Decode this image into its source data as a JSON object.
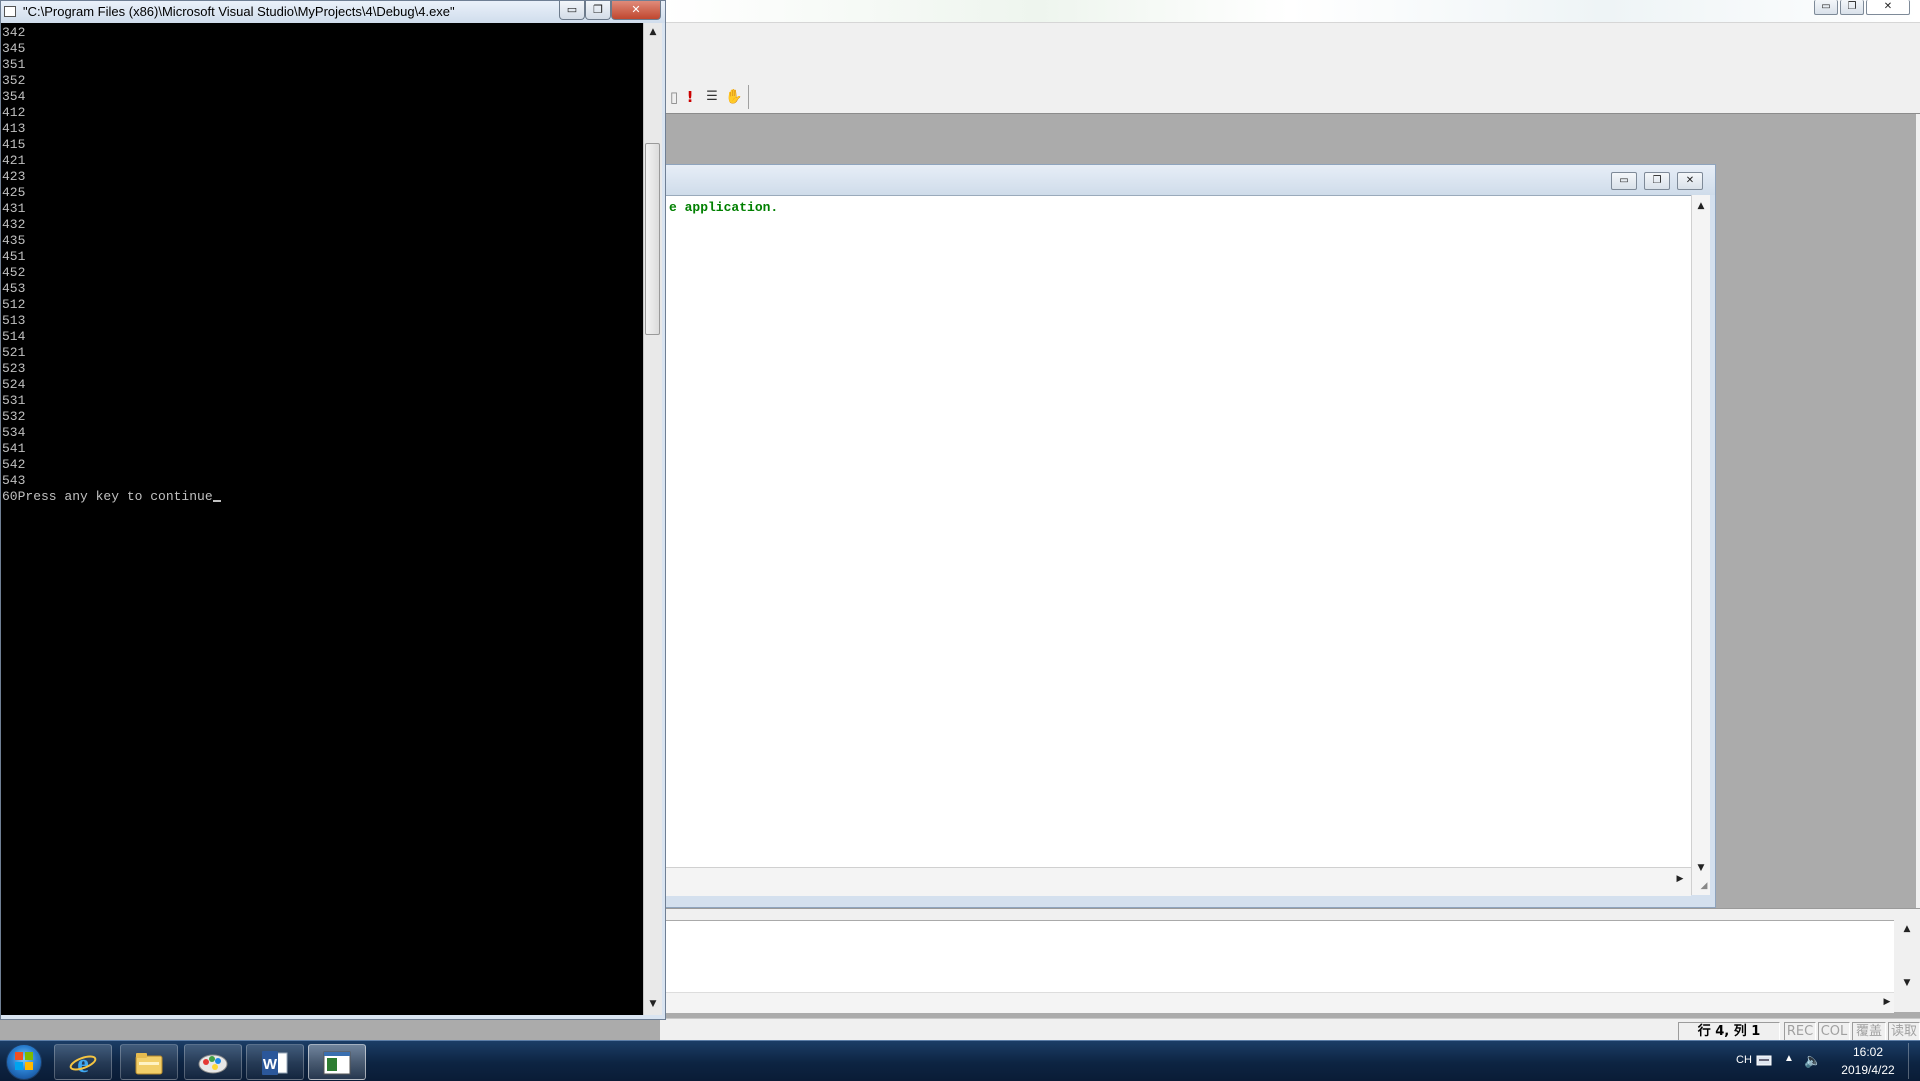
{
  "console": {
    "title": "\"C:\\Program Files (x86)\\Microsoft Visual Studio\\MyProjects\\4\\Debug\\4.exe\"",
    "output_lines": [
      "342",
      "345",
      "351",
      "352",
      "354",
      "412",
      "413",
      "415",
      "421",
      "423",
      "425",
      "431",
      "432",
      "435",
      "451",
      "452",
      "453",
      "512",
      "513",
      "514",
      "521",
      "523",
      "524",
      "531",
      "532",
      "534",
      "541",
      "542",
      "543"
    ],
    "last_line": "60Press any key to continue",
    "buttons": {
      "minimize": "▭",
      "restore": "❐",
      "close": "✕"
    }
  },
  "ide": {
    "editor_text": "e application.",
    "window_buttons": {
      "minimize": "▭",
      "restore": "❐",
      "close": "✕"
    },
    "toolbar_icons": [
      "build-icon",
      "execute-icon",
      "insert-remove-breakpoint-icon",
      "go-hand-icon"
    ]
  },
  "statusbar": {
    "position": "行 4, 列 1",
    "rec": "REC",
    "col": "COL",
    "ovr": "覆盖",
    "read": "读取"
  },
  "taskbar": {
    "apps": [
      "internet-explorer",
      "windows-explorer",
      "paint-app",
      "microsoft-word",
      "visual-cpp-console"
    ],
    "word_letter": "W",
    "ime": "CH",
    "time": "16:02",
    "date": "2019/4/22"
  }
}
